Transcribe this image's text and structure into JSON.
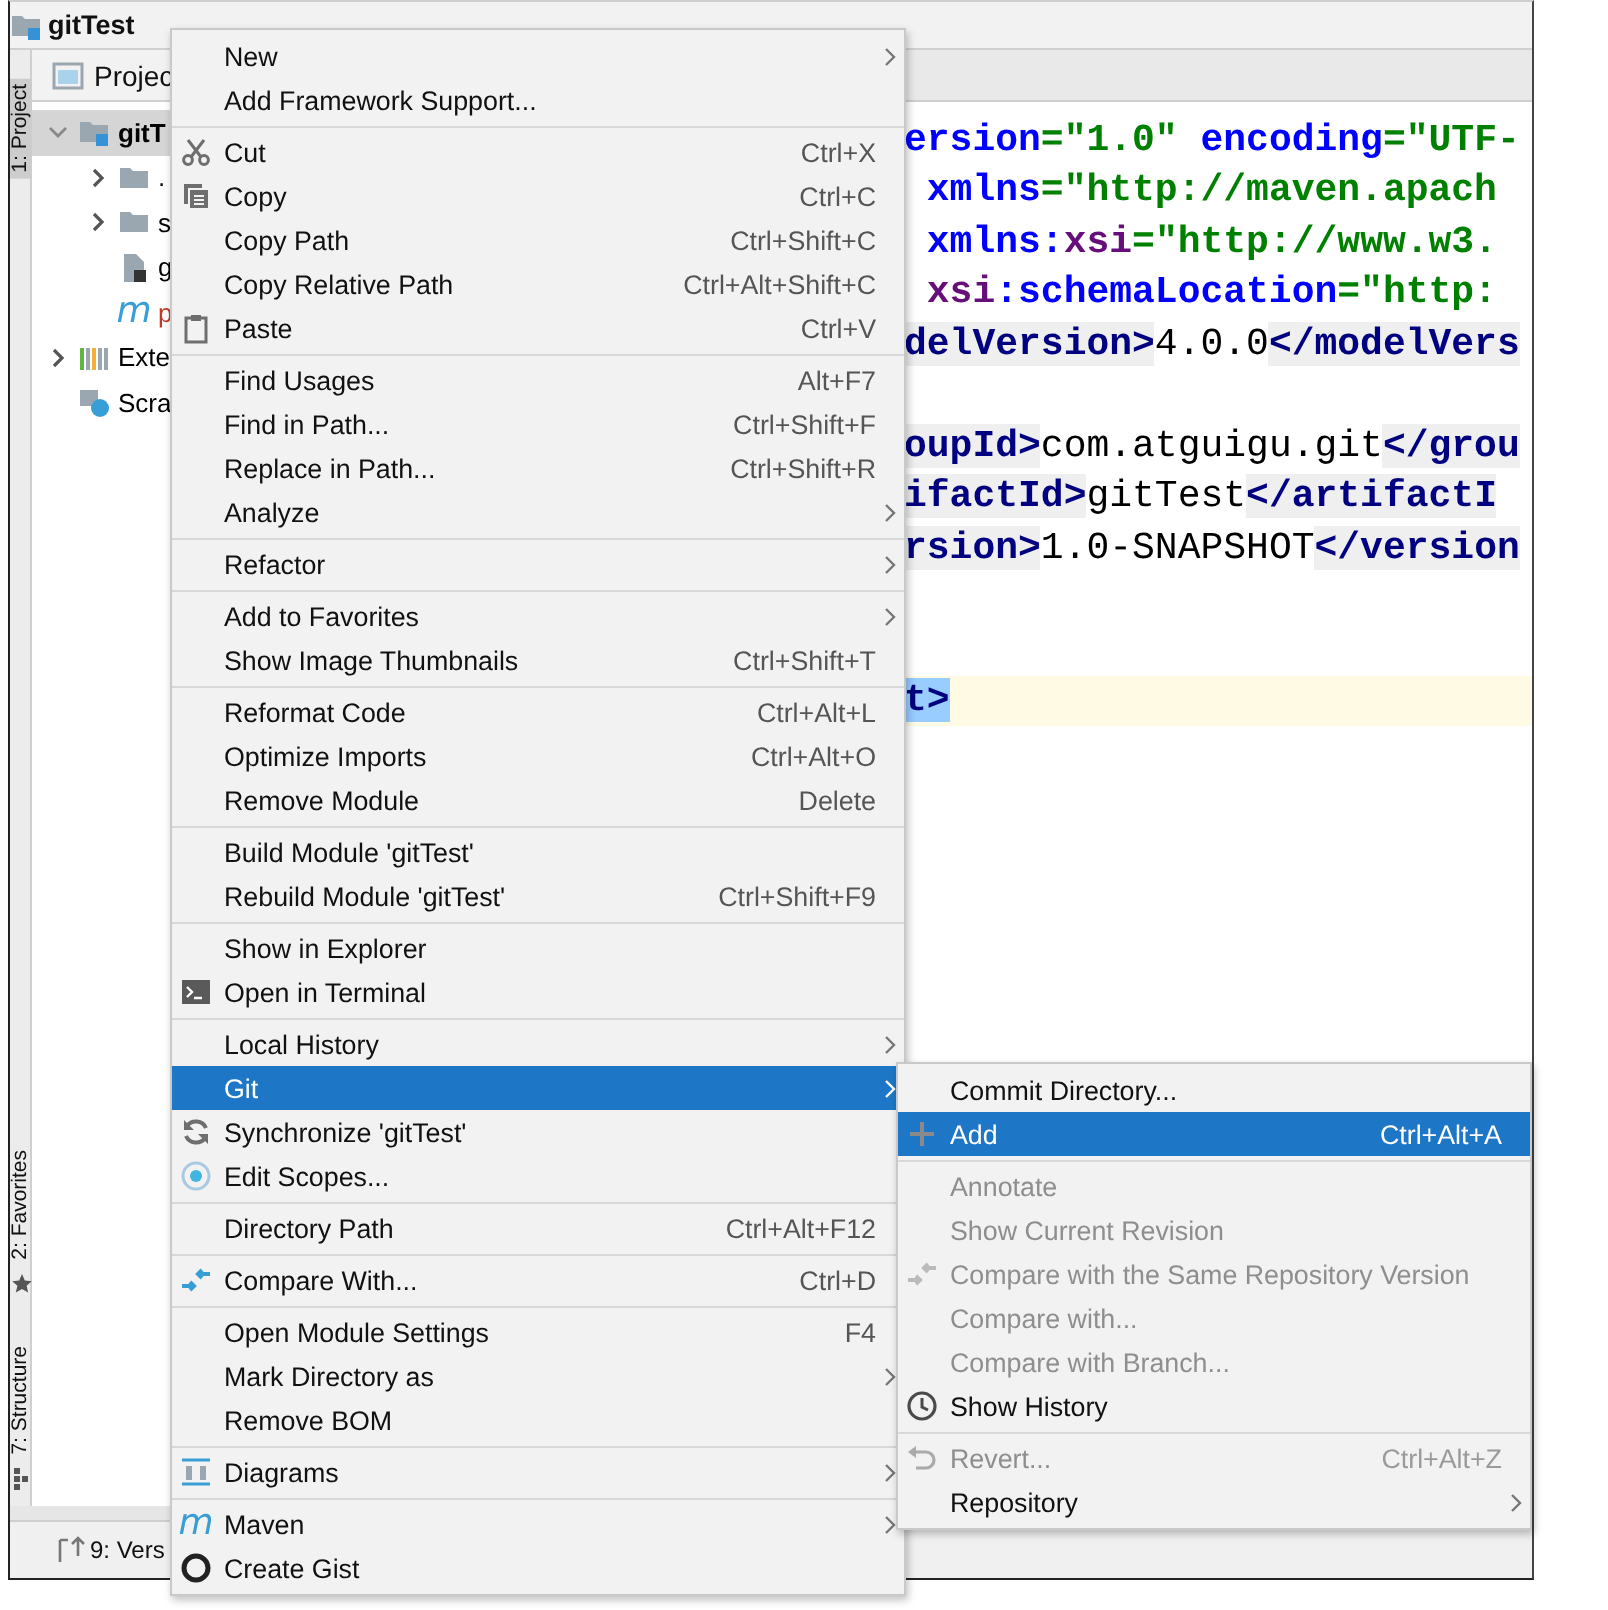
{
  "window": {
    "title": "gitTest"
  },
  "tool_strip": [
    {
      "label": "1: Project",
      "selected": true
    },
    {
      "label": "2: Favorites",
      "selected": false
    },
    {
      "label": "7: Structure",
      "selected": false
    }
  ],
  "project": {
    "tab": "Projec",
    "tree": [
      {
        "label": "gitT",
        "selected": true,
        "expanded": true,
        "color": "#000000",
        "children": [
          {
            "label": ".",
            "selected": false,
            "expanded": false
          },
          {
            "label": "s",
            "selected": false,
            "expanded": false,
            "color": "#000000"
          },
          {
            "label": "g",
            "selected": false,
            "color": "#000000"
          },
          {
            "label": "p",
            "icon_char": "m",
            "selected": false,
            "color": "#c0392b"
          }
        ]
      },
      {
        "label": "Exte",
        "selected": false,
        "expanded": false,
        "color": "#000000"
      },
      {
        "label": "Scra",
        "selected": false,
        "color": "#000000"
      }
    ]
  },
  "editor": {
    "lines": [
      {
        "current": false,
        "tokens": [
          {
            "kind": "attr",
            "text": "ersion"
          },
          {
            "kind": "value",
            "text": "=\"1.0\""
          },
          {
            "kind": "attr",
            "text": " encoding"
          },
          {
            "kind": "value",
            "text": "=\"UTF-"
          }
        ]
      },
      {
        "current": false,
        "tokens": [
          {
            "kind": "attr",
            "text": " xmlns"
          },
          {
            "kind": "value",
            "text": "=\"http://maven.apach"
          }
        ]
      },
      {
        "current": false,
        "tokens": [
          {
            "kind": "attr",
            "text": " xmlns:"
          },
          {
            "kind": "ns",
            "text": "xsi"
          },
          {
            "kind": "value",
            "text": "=\"http://www.w3."
          }
        ]
      },
      {
        "current": false,
        "tokens": [
          {
            "kind": "ns",
            "text": " xsi"
          },
          {
            "kind": "attr",
            "text": ":schemaLocation"
          },
          {
            "kind": "value",
            "text": "=\"http:"
          }
        ]
      },
      {
        "current": false,
        "tokens": [
          {
            "kind": "tag",
            "text": "delVersion>"
          },
          {
            "kind": "text",
            "text": "4.0.0"
          },
          {
            "kind": "tag",
            "text": "</modelVers"
          }
        ]
      },
      {
        "current": false
      },
      {
        "current": false,
        "tokens": [
          {
            "kind": "tag",
            "text": "oupId>"
          },
          {
            "kind": "text",
            "text": "com.atguigu.git"
          },
          {
            "kind": "tag",
            "text": "</grou"
          }
        ]
      },
      {
        "current": false,
        "tokens": [
          {
            "kind": "tag",
            "text": "ifactId>"
          },
          {
            "kind": "text",
            "text": "gitTest"
          },
          {
            "kind": "tag",
            "text": "</artifactI"
          }
        ]
      },
      {
        "current": false,
        "tokens": [
          {
            "kind": "tag",
            "text": "rsion>"
          },
          {
            "kind": "text",
            "text": "1.0-SNAPSHOT"
          },
          {
            "kind": "tag",
            "text": "</version"
          }
        ]
      },
      {
        "current": false
      },
      {
        "current": false
      },
      {
        "current": true,
        "tokens": [
          {
            "kind": "match",
            "text": "t>"
          }
        ]
      }
    ]
  },
  "bottom_bar": {
    "tab": "9: Vers"
  },
  "context_menu": {
    "items": [
      {
        "kind": "item",
        "label": "New",
        "submenu": true,
        "selected": false
      },
      {
        "kind": "item",
        "label": "Add Framework Support...",
        "selected": false
      },
      {
        "kind": "separator"
      },
      {
        "kind": "item",
        "label": "Cut",
        "shortcut": "Ctrl+X",
        "selected": false
      },
      {
        "kind": "item",
        "label": "Copy",
        "shortcut": "Ctrl+C",
        "selected": false
      },
      {
        "kind": "item",
        "label": "Copy Path",
        "shortcut": "Ctrl+Shift+C",
        "selected": false
      },
      {
        "kind": "item",
        "label": "Copy Relative Path",
        "shortcut": "Ctrl+Alt+Shift+C",
        "selected": false
      },
      {
        "kind": "item",
        "label": "Paste",
        "shortcut": "Ctrl+V",
        "selected": false
      },
      {
        "kind": "separator"
      },
      {
        "kind": "item",
        "label": "Find Usages",
        "shortcut": "Alt+F7",
        "selected": false
      },
      {
        "kind": "item",
        "label": "Find in Path...",
        "shortcut": "Ctrl+Shift+F",
        "selected": false
      },
      {
        "kind": "item",
        "label": "Replace in Path...",
        "shortcut": "Ctrl+Shift+R",
        "selected": false
      },
      {
        "kind": "item",
        "label": "Analyze",
        "submenu": true,
        "selected": false
      },
      {
        "kind": "separator"
      },
      {
        "kind": "item",
        "label": "Refactor",
        "submenu": true,
        "selected": false
      },
      {
        "kind": "separator"
      },
      {
        "kind": "item",
        "label": "Add to Favorites",
        "submenu": true,
        "selected": false
      },
      {
        "kind": "item",
        "label": "Show Image Thumbnails",
        "shortcut": "Ctrl+Shift+T",
        "selected": false
      },
      {
        "kind": "separator"
      },
      {
        "kind": "item",
        "label": "Reformat Code",
        "shortcut": "Ctrl+Alt+L",
        "selected": false
      },
      {
        "kind": "item",
        "label": "Optimize Imports",
        "shortcut": "Ctrl+Alt+O",
        "selected": false
      },
      {
        "kind": "item",
        "label": "Remove Module",
        "shortcut": "Delete",
        "selected": false
      },
      {
        "kind": "separator"
      },
      {
        "kind": "item",
        "label": "Build Module 'gitTest'",
        "selected": false
      },
      {
        "kind": "item",
        "label": "Rebuild Module 'gitTest'",
        "shortcut": "Ctrl+Shift+F9",
        "selected": false
      },
      {
        "kind": "separator"
      },
      {
        "kind": "item",
        "label": "Show in Explorer",
        "selected": false
      },
      {
        "kind": "item",
        "label": "Open in Terminal",
        "selected": false
      },
      {
        "kind": "separator"
      },
      {
        "kind": "item",
        "label": "Local History",
        "submenu": true,
        "selected": false
      },
      {
        "kind": "item",
        "label": "Git",
        "submenu": true,
        "selected": true
      },
      {
        "kind": "item",
        "label": "Synchronize 'gitTest'",
        "selected": false
      },
      {
        "kind": "item",
        "label": "Edit Scopes...",
        "selected": false
      },
      {
        "kind": "separator"
      },
      {
        "kind": "item",
        "label": "Directory Path",
        "shortcut": "Ctrl+Alt+F12",
        "selected": false
      },
      {
        "kind": "separator"
      },
      {
        "kind": "item",
        "label": "Compare With...",
        "shortcut": "Ctrl+D",
        "selected": false
      },
      {
        "kind": "separator"
      },
      {
        "kind": "item",
        "label": "Open Module Settings",
        "shortcut": "F4",
        "selected": false
      },
      {
        "kind": "item",
        "label": "Mark Directory as",
        "submenu": true,
        "selected": false
      },
      {
        "kind": "item",
        "label": "Remove BOM",
        "selected": false
      },
      {
        "kind": "separator"
      },
      {
        "kind": "item",
        "label": "Diagrams",
        "submenu": true,
        "selected": false
      },
      {
        "kind": "separator"
      },
      {
        "kind": "item",
        "label": "Maven",
        "icon_char": "m",
        "submenu": true,
        "selected": false
      },
      {
        "kind": "item",
        "label": "Create Gist",
        "selected": false
      }
    ]
  },
  "git_submenu": {
    "items": [
      {
        "kind": "item",
        "label": "Commit Directory...",
        "selected": false,
        "disabled": false
      },
      {
        "kind": "item",
        "label": "Add",
        "shortcut": "Ctrl+Alt+A",
        "selected": true,
        "disabled": false
      },
      {
        "kind": "separator"
      },
      {
        "kind": "item",
        "label": "Annotate",
        "selected": false,
        "disabled": true
      },
      {
        "kind": "item",
        "label": "Show Current Revision",
        "selected": false,
        "disabled": true
      },
      {
        "kind": "item",
        "label": "Compare with the Same Repository Version",
        "selected": false,
        "disabled": true
      },
      {
        "kind": "item",
        "label": "Compare with...",
        "selected": false,
        "disabled": true
      },
      {
        "kind": "item",
        "label": "Compare with Branch...",
        "selected": false,
        "disabled": true
      },
      {
        "kind": "item",
        "label": "Show History",
        "selected": false,
        "disabled": false
      },
      {
        "kind": "separator"
      },
      {
        "kind": "item",
        "label": "Revert...",
        "shortcut": "Ctrl+Alt+Z",
        "selected": false,
        "disabled": true
      },
      {
        "kind": "item",
        "label": "Repository",
        "submenu": true,
        "selected": false,
        "disabled": false
      }
    ]
  }
}
